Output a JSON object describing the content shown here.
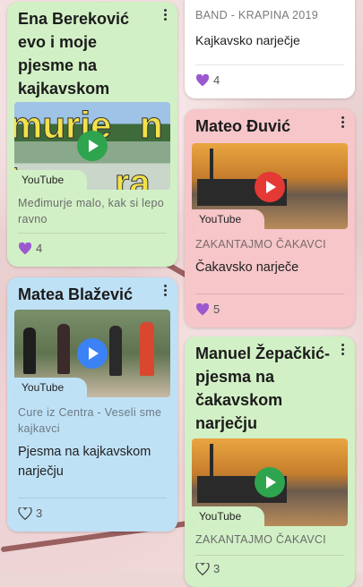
{
  "platform": "YouTube",
  "cards": {
    "ena": {
      "title": "Ena Bereković evo i moje pjesme na  kajkavskom narječju.",
      "thumb_overlay": "murje n lepo ra",
      "description": "Međimurje malo, kak si lepo ravno",
      "likes": "4"
    },
    "band": {
      "meta": "BAND - KRAPINA 2019",
      "body": "Kajkavsko narječje",
      "likes": "4"
    },
    "mateo": {
      "title": "Mateo Đuvić",
      "meta": "ZAKANTAJMO ČAKAVCI",
      "body": "Čakavsko narječe",
      "likes": "5"
    },
    "matea": {
      "title": "Matea Blažević",
      "description": "Cure iz Centra -  Veseli sme kajkavci",
      "body": "Pjesma na kajkavskom narječju",
      "likes": "3"
    },
    "manuel": {
      "title": "Manuel Žepačkić-pjesma na čakavskom narječju",
      "meta": "ZAKANTAJMO ČAKAVCI",
      "likes": "3"
    }
  },
  "colors": {
    "green_card": "#d2f0c6",
    "pink_card": "#f6c6c9",
    "blue_card": "#bfe1f6",
    "heart": "#9b59d0",
    "play_green": "#2ea44f",
    "play_red": "#e53935",
    "play_blue": "#3b82f6"
  }
}
